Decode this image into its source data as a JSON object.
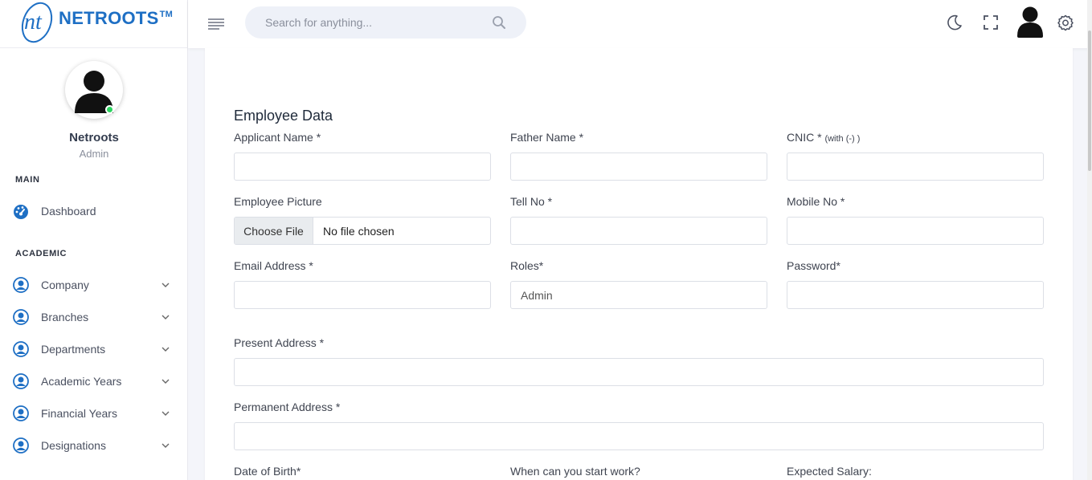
{
  "brand": {
    "name": "NETROOTS",
    "tm": "TM",
    "mark": "nt"
  },
  "profile": {
    "name": "Netroots",
    "role": "Admin"
  },
  "sidebar": {
    "sections": [
      {
        "title": "MAIN"
      },
      {
        "title": "ACADEMIC"
      }
    ],
    "items": [
      {
        "label": "Dashboard",
        "icon": "dashboard-icon"
      },
      {
        "label": "Company",
        "icon": "user-circle-icon"
      },
      {
        "label": "Branches",
        "icon": "user-circle-icon"
      },
      {
        "label": "Departments",
        "icon": "user-circle-icon"
      },
      {
        "label": "Academic Years",
        "icon": "user-circle-icon"
      },
      {
        "label": "Financial Years",
        "icon": "user-circle-icon"
      },
      {
        "label": "Designations",
        "icon": "user-circle-icon"
      }
    ]
  },
  "search": {
    "placeholder": "Search for anything..."
  },
  "form": {
    "title": "Employee Data",
    "applicant_name": "Applicant Name *",
    "father_name": "Father Name *",
    "cnic": "CNIC *",
    "cnic_hint": "(with (-) )",
    "employee_picture": "Employee Picture",
    "file_button": "Choose File",
    "file_status": "No file chosen",
    "tell_no": "Tell No *",
    "mobile_no": "Mobile No *",
    "email": "Email Address *",
    "roles": "Roles*",
    "roles_value": "Admin",
    "password": "Password*",
    "present_address": "Present Address *",
    "permanent_address": "Permanent Address *",
    "dob": "Date of Birth*",
    "start_work": "When can you start work?",
    "expected_salary": "Expected Salary:"
  },
  "colors": {
    "accent": "#1e6fc4",
    "online": "#2bd45f",
    "search_bg": "#eef1f8"
  }
}
